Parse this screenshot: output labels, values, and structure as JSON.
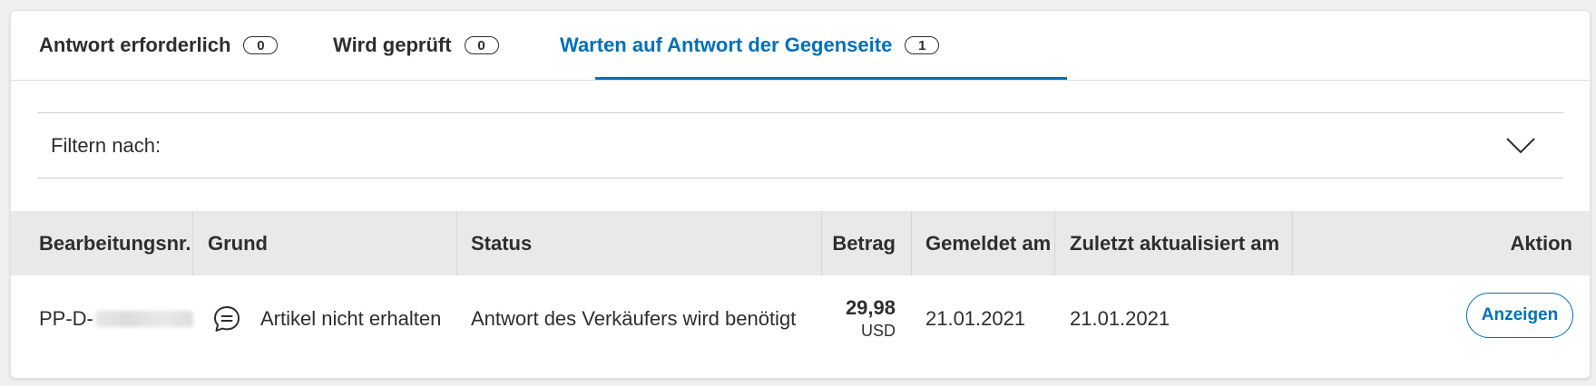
{
  "tabs": [
    {
      "label": "Antwort erforderlich",
      "count": "0"
    },
    {
      "label": "Wird geprüft",
      "count": "0"
    },
    {
      "label": "Warten auf Antwort der Gegenseite",
      "count": "1"
    }
  ],
  "active_tab": 2,
  "colors": {
    "accent": "#0070ba",
    "header_bg": "#e9e9ea",
    "text": "#2c2e2f"
  },
  "filter": {
    "label": "Filtern nach:",
    "icon": "chevron-down-icon"
  },
  "table": {
    "columns": [
      "Bearbeitungsnr.",
      "Grund",
      "Status",
      "Betrag",
      "Gemeldet am",
      "Zuletzt aktualisiert am",
      "Aktion"
    ],
    "rows": [
      {
        "case_id_prefix": "PP-D-",
        "reason_icon": "chat-bubble-icon",
        "reason": "Artikel nicht erhalten",
        "status": "Antwort des Verkäufers wird benötigt",
        "amount": "29,98",
        "currency": "USD",
        "reported": "21.01.2021",
        "updated": "21.01.2021",
        "action": "Anzeigen"
      }
    ]
  }
}
